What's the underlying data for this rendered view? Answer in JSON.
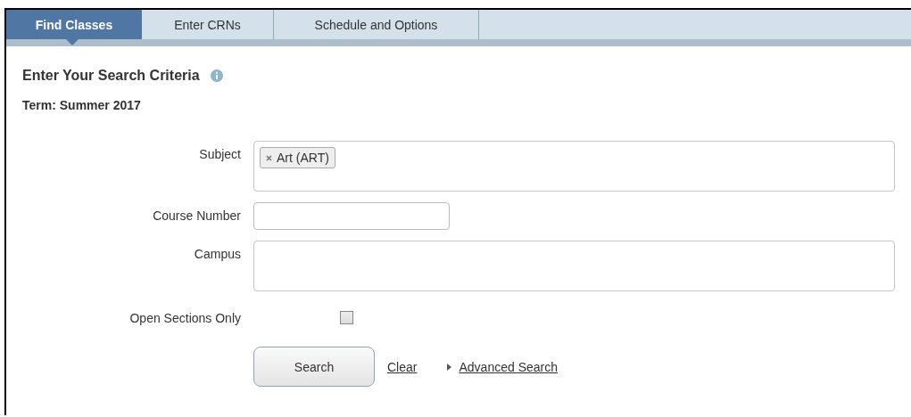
{
  "tabs": [
    {
      "label": "Find Classes",
      "selected": true
    },
    {
      "label": "Enter CRNs",
      "selected": false
    },
    {
      "label": "Schedule and Options",
      "selected": false
    }
  ],
  "heading": "Enter Your Search Criteria",
  "term": "Term: Summer 2017",
  "fields": [
    {
      "kind": "tags",
      "label": "Subject",
      "tags": [
        "Art (ART)"
      ]
    },
    {
      "kind": "text",
      "label": "Course Number"
    },
    {
      "kind": "tags",
      "label": "Campus"
    },
    {
      "kind": "checkbox",
      "label": "Open Sections Only",
      "checked": false
    }
  ],
  "search_button": "Search",
  "clear_link": "Clear",
  "advanced_link": "Advanced Search"
}
